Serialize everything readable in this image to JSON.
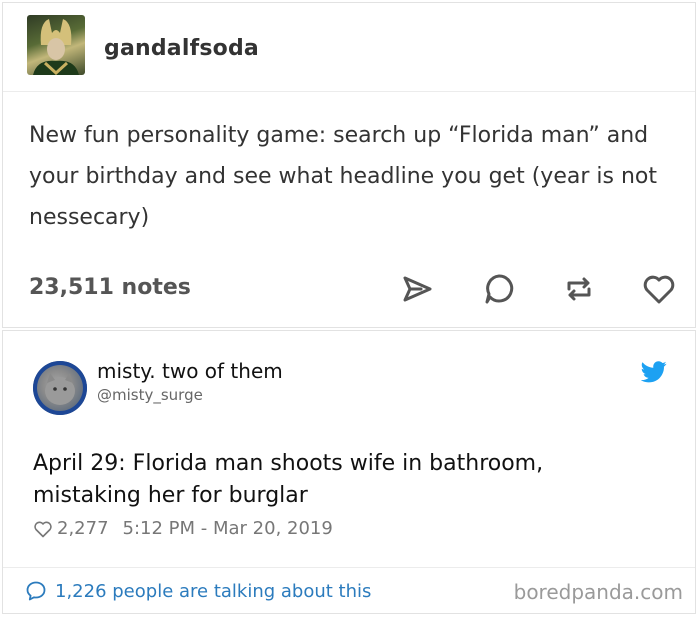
{
  "tumblr": {
    "username": "gandalfsoda",
    "post_text": "New fun personality game: search up “Florida man” and your birthday and see what headline you get (year is not nessecary)",
    "notes": "23,511 notes"
  },
  "tweet": {
    "display_name": "misty. two of them",
    "handle": "@misty_surge",
    "text": "April 29: Florida man shoots wife in bathroom, mistaking her for burglar",
    "likes": "2,277",
    "timestamp": "5:12 PM - Mar 20, 2019",
    "talking": "1,226 people are talking about this"
  },
  "watermark": "boredpanda.com",
  "colors": {
    "tumblr_icon": "#555555",
    "twitter_blue": "#1da1f2",
    "link_blue": "#2b7bbd"
  }
}
